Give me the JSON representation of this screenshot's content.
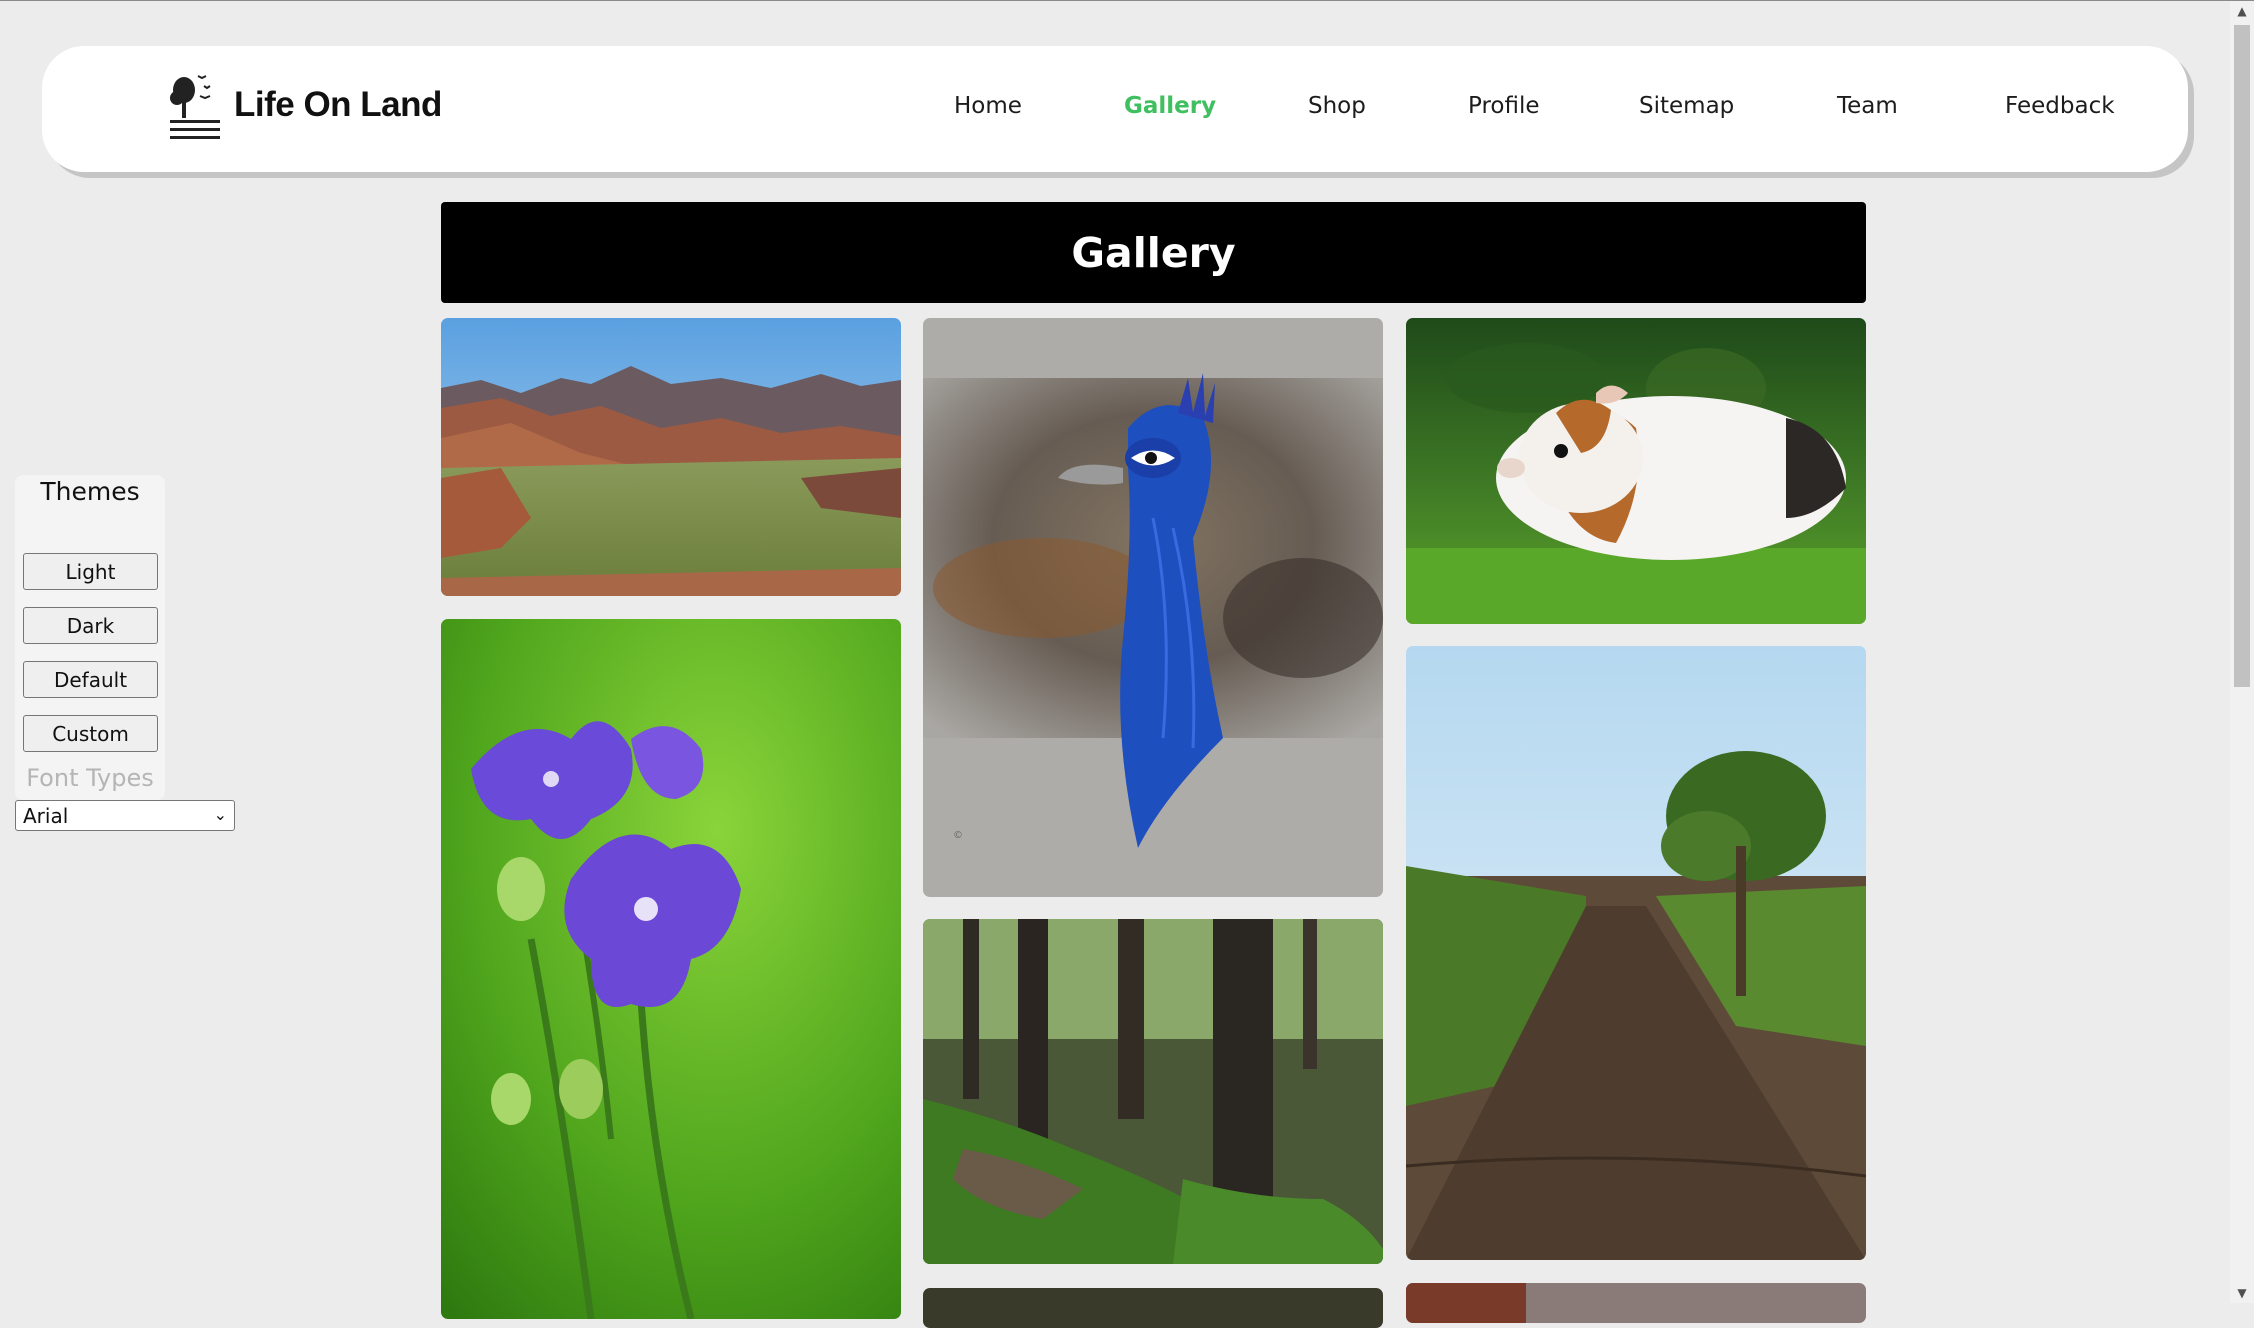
{
  "header": {
    "logo_text": "Life On Land",
    "nav": [
      {
        "label": "Home",
        "active": false
      },
      {
        "label": "Gallery",
        "active": true
      },
      {
        "label": "Shop",
        "active": false
      },
      {
        "label": "Profile",
        "active": false
      },
      {
        "label": "Sitemap",
        "active": false
      },
      {
        "label": "Team",
        "active": false
      },
      {
        "label": "Feedback",
        "active": false
      }
    ],
    "active_color": "#3fbf5f"
  },
  "main": {
    "title": "Gallery",
    "photos": [
      {
        "subject": "canyon-valley"
      },
      {
        "subject": "peacock-painting"
      },
      {
        "subject": "guinea-pig"
      },
      {
        "subject": "purple-balloon-flower"
      },
      {
        "subject": "mossy-forest"
      },
      {
        "subject": "cornfield-with-tree"
      }
    ]
  },
  "themes_panel": {
    "title": "Themes",
    "buttons": [
      "Light",
      "Dark",
      "Default",
      "Custom"
    ],
    "font_label": "Font Types",
    "font_selected": "Arial"
  },
  "colors": {
    "page_bg": "#ececec",
    "title_bar_bg": "#000000",
    "title_text": "#ffffff"
  }
}
